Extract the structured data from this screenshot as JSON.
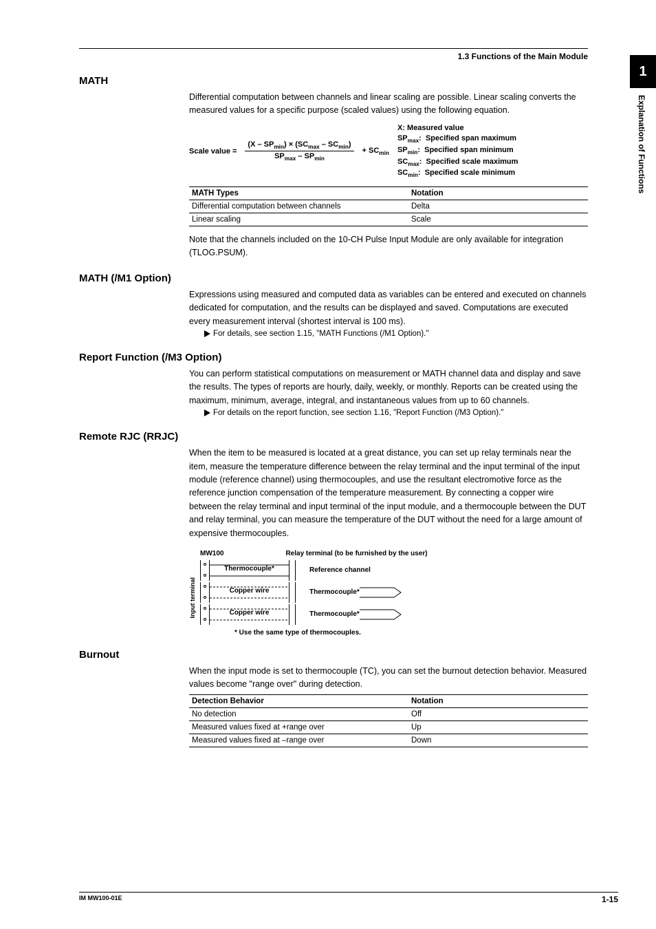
{
  "header": {
    "section": "1.3  Functions of the Main Module"
  },
  "sidetab": {
    "chapter": "1",
    "label": "Explanation of Functions"
  },
  "math": {
    "title": "MATH",
    "intro": "Differential computation between channels and linear scaling are possible. Linear scaling converts the measured values for a specific purpose (scaled values) using the following equation.",
    "eq_lhs": "Scale value =",
    "eq_num": "(X – SPmin) × (SCmax – SCmin)",
    "eq_den": "SPmax – SPmin",
    "eq_plus": "+ SCmin",
    "legend": {
      "x": "X: Measured value",
      "spmax": "SPmax:  Specified span maximum",
      "spmin": "SPmin:  Specified span minimum",
      "scmax": "SCmax:  Specified scale maximum",
      "scmin": "SCmin:  Specified scale minimum"
    },
    "table": {
      "h1": "MATH Types",
      "h2": "Notation",
      "r1c1": "Differential computation between channels",
      "r1c2": "Delta",
      "r2c1": "Linear scaling",
      "r2c2": "Scale"
    },
    "note": "Note that the channels included on the 10-CH Pulse Input Module are only available for integration (TLOG.PSUM)."
  },
  "m1": {
    "title": "MATH (/M1 Option)",
    "body": "Expressions using measured and computed data as variables can be entered and executed on channels dedicated for computation, and the results can be displayed and saved. Computations are executed every measurement interval (shortest interval is 100 ms).",
    "ref": "For details, see section 1.15, \"MATH Functions (/M1 Option).\""
  },
  "m3": {
    "title": "Report Function (/M3 Option)",
    "body": "You can perform statistical computations on measurement or MATH channel data and display and save the results. The types of reports are hourly, daily, weekly, or monthly. Reports can be created using the maximum, minimum, average, integral, and instantaneous values from up to 60 channels.",
    "ref": "For details on the report function, see section 1.16, \"Report Function (/M3 Option).\""
  },
  "rrjc": {
    "title": "Remote RJC (RRJC)",
    "body": "When the item to be measured is located at a great distance, you can set up relay terminals near the item, measure the temperature difference between the relay terminal and the input terminal of the input module (reference channel) using thermocouples, and use the resultant electromotive force as the reference junction compensation of the temperature measurement. By connecting a copper wire between the relay terminal and input terminal of the input module, and a thermocouple between the DUT and relay terminal, you can measure the temperature of the DUT without the need for a large amount of expensive thermocouples.",
    "dia": {
      "mw": "MW100",
      "relay": "Relay terminal (to be furnished by the user)",
      "tc": "Thermocouple*",
      "cw": "Copper wire",
      "refch": "Reference channel",
      "input": "Input terminal",
      "foot": "* Use the same type of thermocouples."
    }
  },
  "burnout": {
    "title": "Burnout",
    "body": "When the input mode is set to thermocouple (TC), you can set the burnout detection behavior. Measured values become \"range over\" during detection.",
    "table": {
      "h1": "Detection Behavior",
      "h2": "Notation",
      "r1c1": "No detection",
      "r1c2": "Off",
      "r2c1": "Measured values fixed at +range over",
      "r2c2": "Up",
      "r3c1": "Measured values fixed at –range over",
      "r3c2": "Down"
    }
  },
  "footer": {
    "left": "IM MW100-01E",
    "right": "1-15"
  }
}
